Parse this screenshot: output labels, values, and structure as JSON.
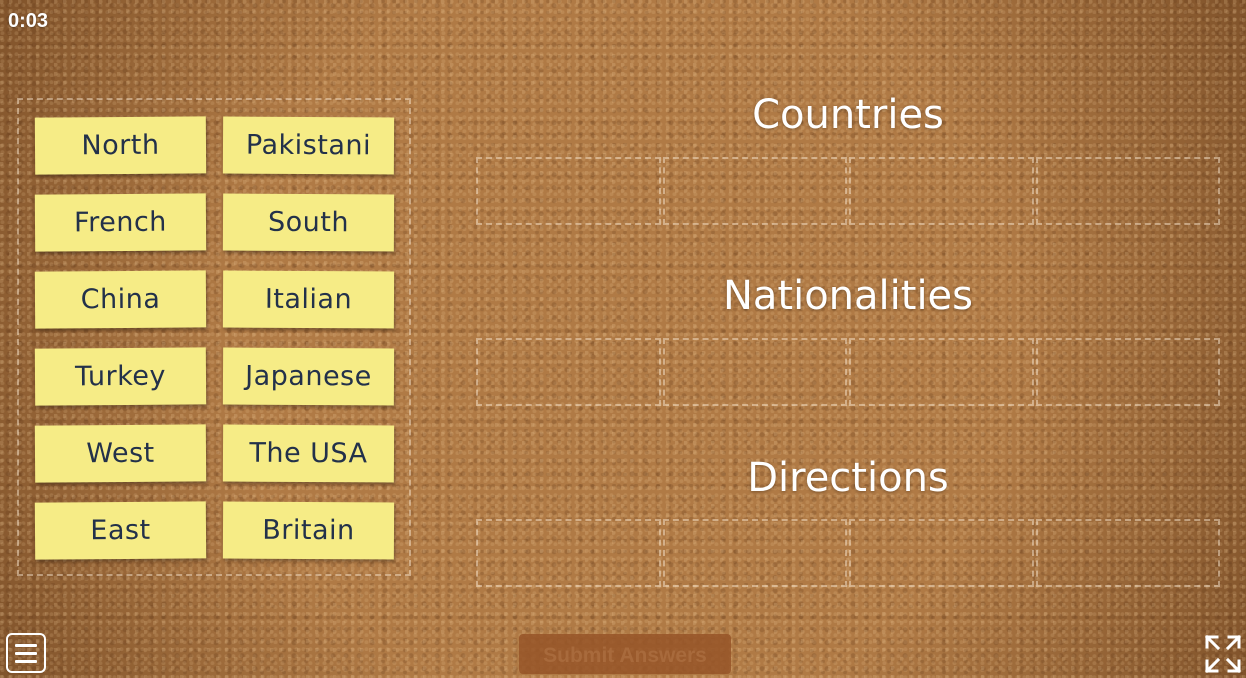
{
  "timer": "0:03",
  "bank": {
    "notes": [
      "North",
      "Pakistani",
      "French",
      "South",
      "China",
      "Italian",
      "Turkey",
      "Japanese",
      "West",
      "The USA",
      "East",
      "Britain"
    ]
  },
  "groups": [
    {
      "title": "Countries"
    },
    {
      "title": "Nationalities"
    },
    {
      "title": "Directions"
    }
  ],
  "footer": {
    "submit_label": "Submit Answers",
    "menu_icon": "hamburger-menu-icon",
    "fullscreen_icon": "fullscreen-icon"
  },
  "colors": {
    "background": "#b07a45",
    "note": "#f6ec86",
    "note_text": "#23314a",
    "title_text": "#ffffff"
  }
}
